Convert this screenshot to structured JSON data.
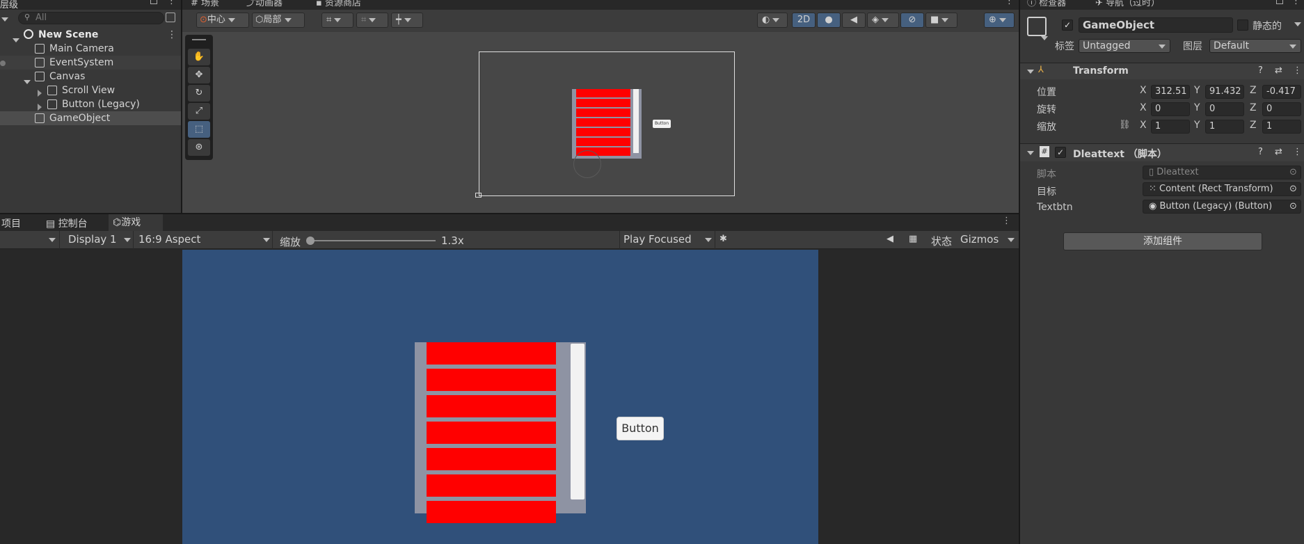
{
  "hierarchy": {
    "tab_label": "层级",
    "search_placeholder": "All",
    "scene_name": "New Scene",
    "items": [
      "Main Camera",
      "EventSystem",
      "Canvas",
      "Scroll View",
      "Button (Legacy)",
      "GameObject"
    ]
  },
  "scene_view": {
    "tabs": [
      "场景",
      "动画器",
      "资源商店"
    ],
    "pivot_label": "中心",
    "space_label": "局部",
    "mode_2d": "2D",
    "mini_button_text": "Button"
  },
  "game_view": {
    "tabs": [
      "项目",
      "控制台",
      "游戏"
    ],
    "display": "Display 1",
    "aspect": "16:9 Aspect",
    "scale_label": "缩放",
    "scale_value": "1.3x",
    "play_mode": "Play Focused",
    "stats_label": "状态",
    "gizmos_label": "Gizmos",
    "button_text": "Button",
    "colors": {
      "background": "#30507a",
      "rows": "#ff0000",
      "frame": "#8e93a3"
    },
    "row_count": 7
  },
  "inspector": {
    "tabs": [
      "检查器",
      "导航（过时）"
    ],
    "object_name": "GameObject",
    "static_label": "静态的",
    "tag_label": "标签",
    "tag_value": "Untagged",
    "layer_label": "图层",
    "layer_value": "Default",
    "transform": {
      "title": "Transform",
      "position_label": "位置",
      "rotation_label": "旋转",
      "scale_label": "缩放",
      "position": {
        "x": "312.51",
        "y": "91.432",
        "z": "-0.417"
      },
      "rotation": {
        "x": "0",
        "y": "0",
        "z": "0"
      },
      "scale": {
        "x": "1",
        "y": "1",
        "z": "1"
      },
      "axis_x": "X",
      "axis_y": "Y",
      "axis_z": "Z"
    },
    "script_component": {
      "title": "Dleattext （脚本）",
      "script_label": "脚本",
      "script_value": "Dleattext",
      "target_label": "目标",
      "target_value": "Content (Rect Transform)",
      "textbtn_label": "Textbtn",
      "textbtn_value": "Button (Legacy) (Button)"
    },
    "add_component": "添加组件"
  }
}
